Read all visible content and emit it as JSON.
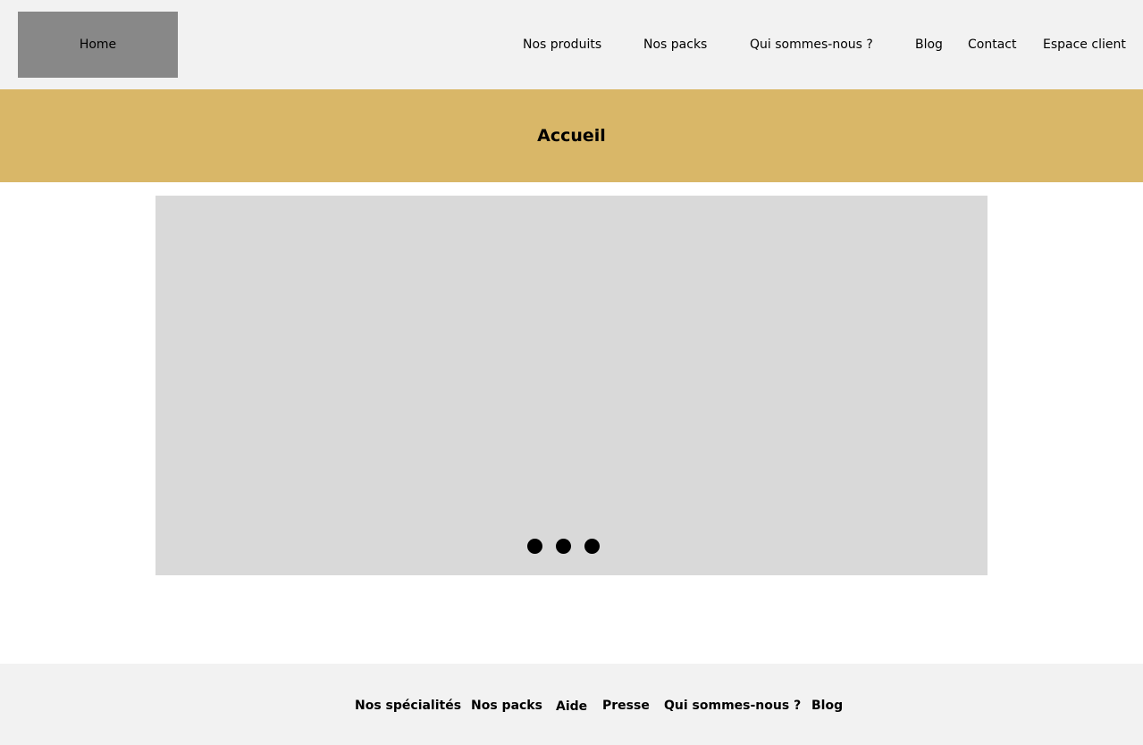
{
  "header": {
    "logo_label": "Home",
    "nav": [
      {
        "label": "Nos produits"
      },
      {
        "label": "Nos packs"
      },
      {
        "label": "Qui sommes-nous ?"
      },
      {
        "label": "Blog"
      },
      {
        "label": "Contact"
      },
      {
        "label": "Espace client"
      }
    ]
  },
  "page": {
    "title": "Accueil"
  },
  "carousel": {
    "slide_count": 3
  },
  "footer": {
    "links": [
      {
        "label": "Nos spécialités"
      },
      {
        "label": "Nos packs"
      },
      {
        "label": "Aide"
      },
      {
        "label": "Presse"
      },
      {
        "label": "Qui sommes-nous ?"
      },
      {
        "label": "Blog"
      }
    ]
  },
  "colors": {
    "header_bg": "#f2f2f2",
    "logo_bg": "#888888",
    "title_band_bg": "#d9b768",
    "carousel_bg": "#d9d9d9",
    "dot": "#000000",
    "footer_bg": "#f2f2f2"
  }
}
